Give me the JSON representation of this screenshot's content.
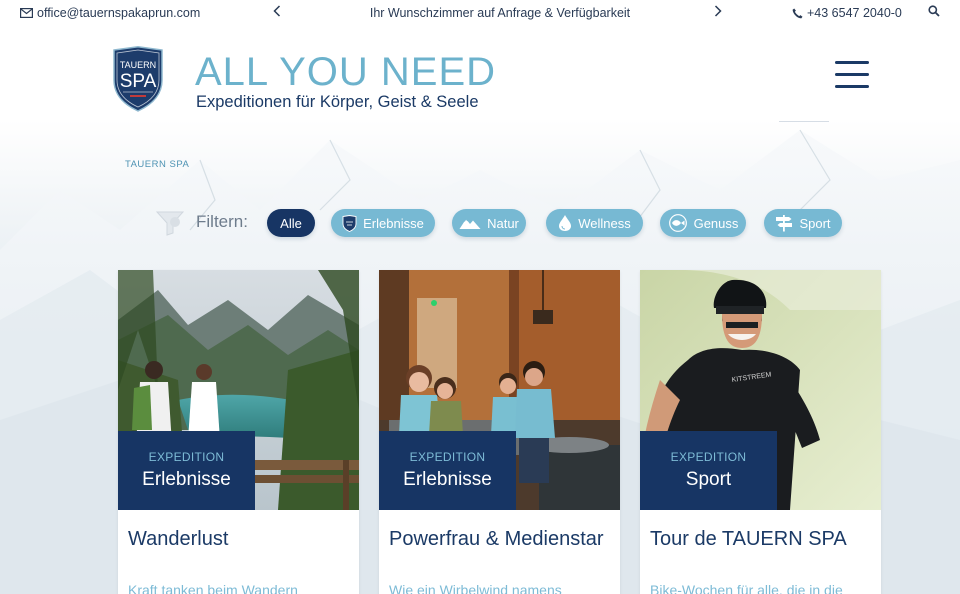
{
  "topbar": {
    "email": "office@tauernspakaprun.com",
    "promo": "Ihr Wunschzimmer auf Anfrage & Verfügbarkeit",
    "prev_icon": "chevron-left-icon",
    "next_icon": "chevron-right-icon",
    "phone": "+43 6547 2040-0"
  },
  "header": {
    "logo_text": "TAUERN SPA",
    "title": "ALL YOU NEED",
    "subtitle": "Expeditionen für Körper, Geist & Seele"
  },
  "breadcrumb": "TAUERN SPA",
  "filters": {
    "label": "Filtern:",
    "chips": [
      {
        "label": "Alle",
        "active": true
      },
      {
        "label": "Erlebnisse",
        "icon": "shield-icon"
      },
      {
        "label": "Natur",
        "icon": "mountain-icon"
      },
      {
        "label": "Wellness",
        "icon": "drop-icon"
      },
      {
        "label": "Genuss",
        "icon": "fish-icon"
      },
      {
        "label": "Sport",
        "icon": "signpost-icon"
      }
    ]
  },
  "cards": [
    {
      "tag_top": "EXPEDITION",
      "tag_bottom": "Erlebnisse",
      "title": "Wanderlust",
      "excerpt": "Kraft tanken beim Wandern"
    },
    {
      "tag_top": "EXPEDITION",
      "tag_bottom": "Erlebnisse",
      "title": "Powerfrau & Medienstar",
      "excerpt": "Wie ein Wirbelwind namens"
    },
    {
      "tag_top": "EXPEDITION",
      "tag_bottom": "Sport",
      "title": "Tour de TAUERN SPA",
      "excerpt": "Bike-Wochen für alle, die in die"
    }
  ],
  "colors": {
    "navy": "#173564",
    "accent": "#77b9d3",
    "title_blue": "#6cb2cc"
  }
}
